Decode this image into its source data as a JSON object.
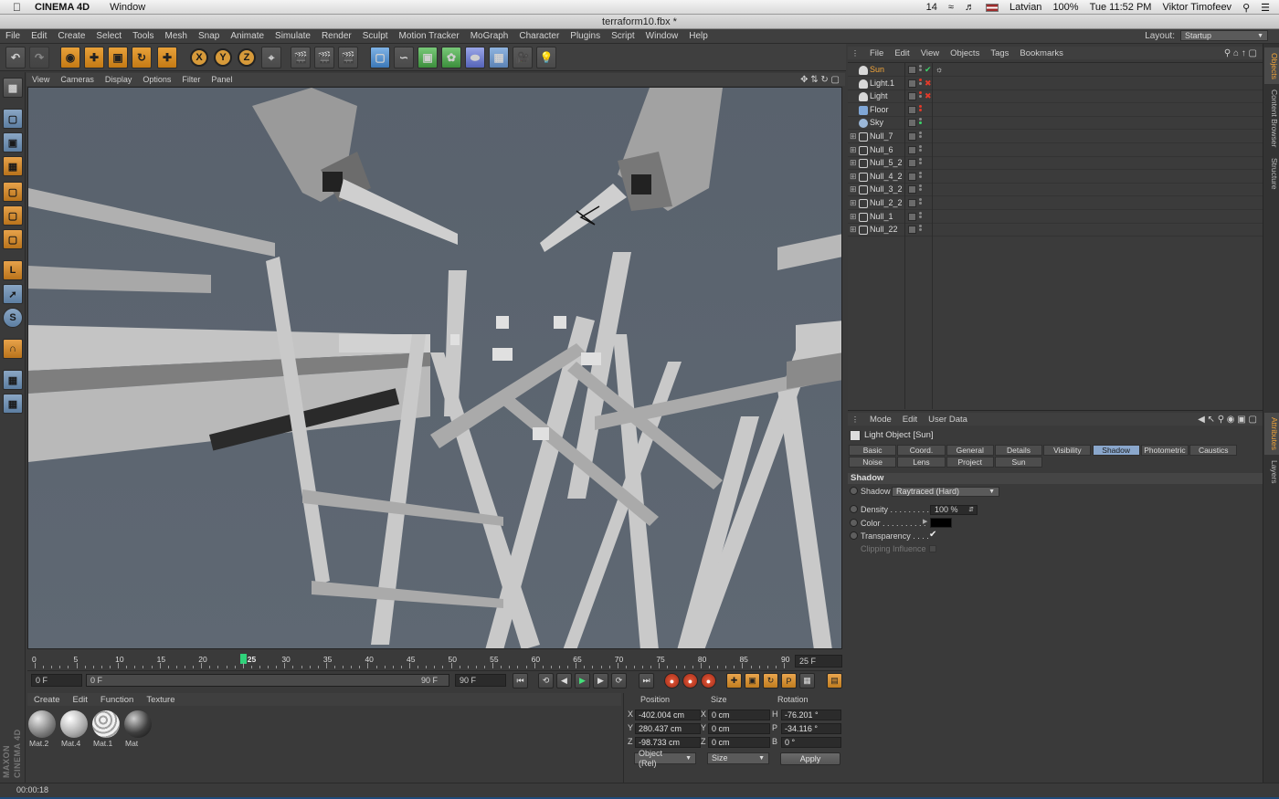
{
  "mac": {
    "app": "CINEMA 4D",
    "menu_window": "Window",
    "wifi_count": "14",
    "language": "Latvian",
    "battery": "100%",
    "clock": "Tue 11:52 PM",
    "user": "Viktor Timofeev"
  },
  "window_title": "terraform10.fbx *",
  "menu": [
    "File",
    "Edit",
    "Create",
    "Select",
    "Tools",
    "Mesh",
    "Snap",
    "Animate",
    "Simulate",
    "Render",
    "Sculpt",
    "Motion Tracker",
    "MoGraph",
    "Character",
    "Plugins",
    "Script",
    "Window",
    "Help"
  ],
  "layout": {
    "label": "Layout:",
    "value": "Startup"
  },
  "viewport_menu": [
    "View",
    "Cameras",
    "Display",
    "Options",
    "Filter",
    "Panel"
  ],
  "timeline": {
    "ticks": [
      "0",
      "5",
      "10",
      "15",
      "20",
      "25",
      "30",
      "35",
      "40",
      "45",
      "50",
      "55",
      "60",
      "65",
      "70",
      "75",
      "80",
      "85",
      "90"
    ],
    "current_frame": "25",
    "end_frame_display": "25 F"
  },
  "transport": {
    "start": "0 F",
    "range_start": "0 F",
    "range_end": "90 F",
    "end": "90 F"
  },
  "material_menu": [
    "Create",
    "Edit",
    "Function",
    "Texture"
  ],
  "materials": [
    {
      "name": "Mat.2",
      "style": "grey"
    },
    {
      "name": "Mat.4",
      "style": "light"
    },
    {
      "name": "Mat.1",
      "style": "pattern"
    },
    {
      "name": "Mat",
      "style": "dark"
    }
  ],
  "coords": {
    "headers": {
      "position": "Position",
      "size": "Size",
      "rotation": "Rotation"
    },
    "rows": [
      {
        "axis": "X",
        "pos": "-402.004 cm",
        "size_axis": "X",
        "size": "0 cm",
        "rot_axis": "H",
        "rot": "-76.201 °"
      },
      {
        "axis": "Y",
        "pos": "280.437 cm",
        "size_axis": "Y",
        "size": "0 cm",
        "rot_axis": "P",
        "rot": "-34.116 °"
      },
      {
        "axis": "Z",
        "pos": "-98.733 cm",
        "size_axis": "Z",
        "size": "0 cm",
        "rot_axis": "B",
        "rot": "0 °"
      }
    ],
    "mode": "Object (Rel)",
    "size_mode": "Size",
    "apply": "Apply"
  },
  "status_time": "00:00:18",
  "brand": "MAXON CINEMA 4D",
  "object_menu": [
    "File",
    "Edit",
    "View",
    "Objects",
    "Tags",
    "Bookmarks"
  ],
  "objects": [
    {
      "name": "Sun",
      "icon": "light-icon",
      "selected": true,
      "status": "check"
    },
    {
      "name": "Light.1",
      "icon": "light-icon",
      "selected": false,
      "status": "x"
    },
    {
      "name": "Light",
      "icon": "light-icon",
      "selected": false,
      "status": "x"
    },
    {
      "name": "Floor",
      "icon": "floor-icon",
      "selected": false,
      "status": ""
    },
    {
      "name": "Sky",
      "icon": "sky-icon",
      "selected": false,
      "status": ""
    },
    {
      "name": "Null_7",
      "icon": "null-icon",
      "selected": false,
      "status": ""
    },
    {
      "name": "Null_6",
      "icon": "null-icon",
      "selected": false,
      "status": ""
    },
    {
      "name": "Null_5_2",
      "icon": "null-icon",
      "selected": false,
      "status": ""
    },
    {
      "name": "Null_4_2",
      "icon": "null-icon",
      "selected": false,
      "status": ""
    },
    {
      "name": "Null_3_2",
      "icon": "null-icon",
      "selected": false,
      "status": ""
    },
    {
      "name": "Null_2_2",
      "icon": "null-icon",
      "selected": false,
      "status": ""
    },
    {
      "name": "Null_1",
      "icon": "null-icon",
      "selected": false,
      "status": ""
    },
    {
      "name": "Null_22",
      "icon": "null-icon",
      "selected": false,
      "status": ""
    }
  ],
  "attr_menu": [
    "Mode",
    "Edit",
    "User Data"
  ],
  "attr_title": "Light Object [Sun]",
  "attr_tabs_row1": [
    "Basic",
    "Coord.",
    "General",
    "Details",
    "Visibility",
    "Shadow",
    "Photometric",
    "Caustics"
  ],
  "attr_tabs_row2": [
    "Noise",
    "Lens",
    "Project",
    "Sun"
  ],
  "attr_active_tab": "Shadow",
  "attr_section": "Shadow",
  "attr_fields": {
    "shadow_label": "Shadow",
    "shadow_value": "Raytraced (Hard)",
    "density_label": "Density . . . . . . . . .",
    "density_value": "100 %",
    "color_label": "Color . . . . . . . . . .",
    "transparency_label": "Transparency . . . .",
    "clipping_label": "Clipping Influence"
  },
  "right_tabs_top": [
    "Objects",
    "Content Browser",
    "Structure"
  ],
  "right_tabs_bottom": [
    "Attributes",
    "Layers"
  ]
}
